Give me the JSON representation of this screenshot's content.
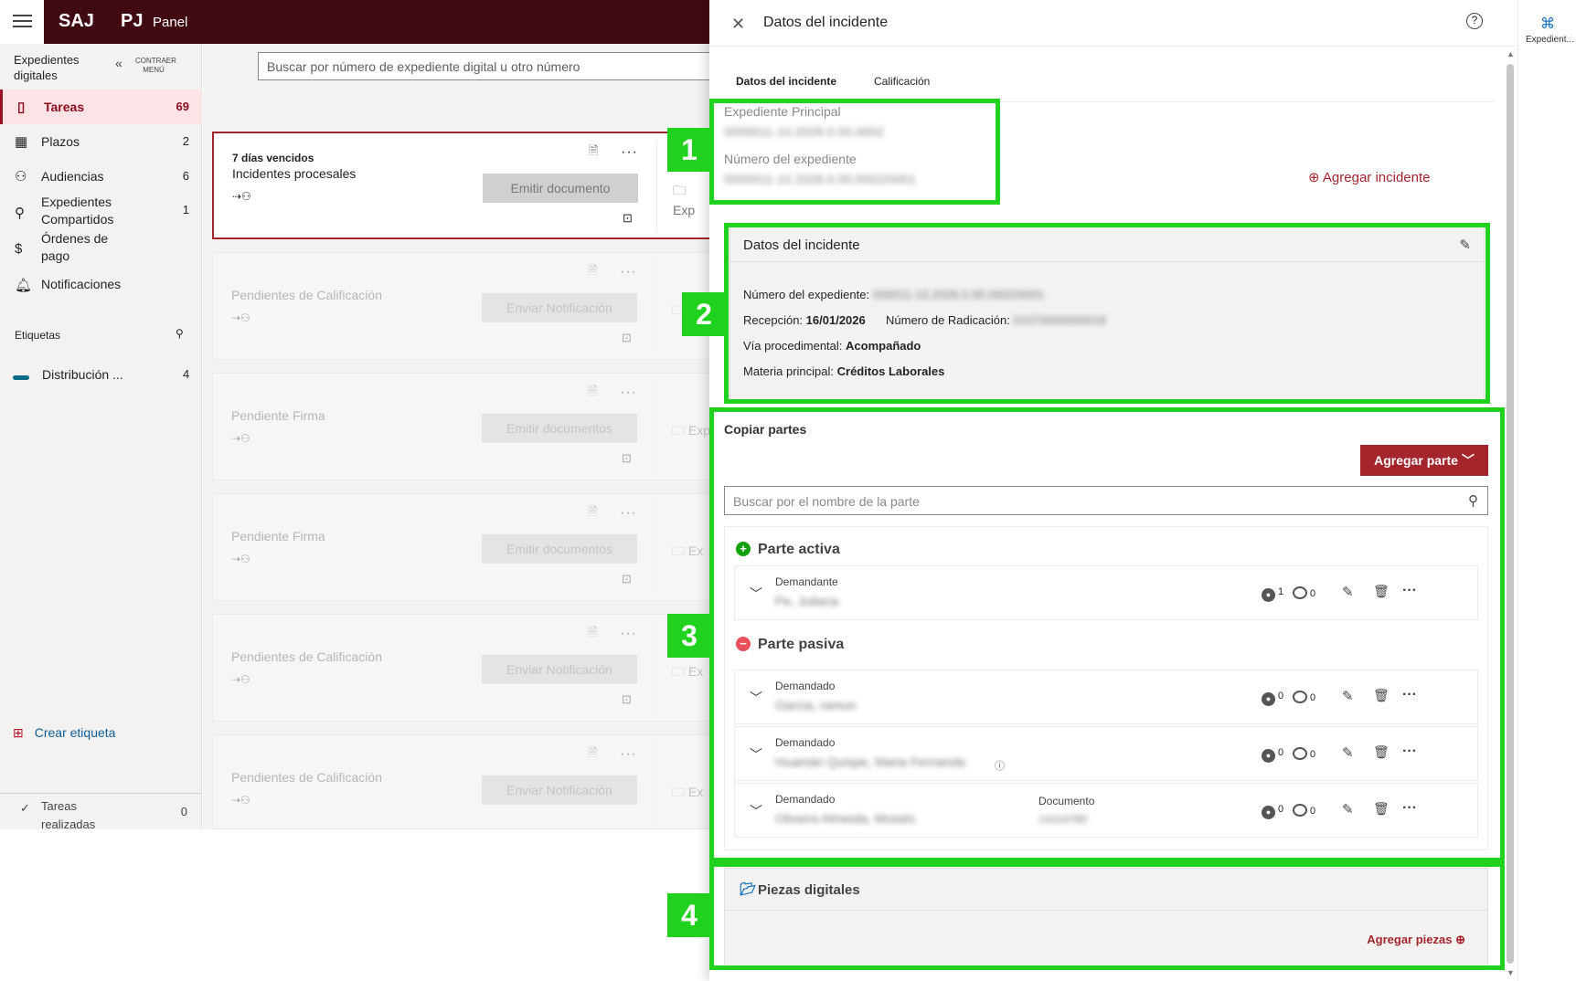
{
  "topbar": {
    "brand1": "SAJ",
    "brand2": "PJ",
    "brand3": "Panel"
  },
  "sidebar": {
    "title": "Expedientes digitales",
    "collapse_label": "CONTRAER MENÚ",
    "items": [
      {
        "label": "Tareas",
        "count": "69",
        "icon": "bookmark-icon"
      },
      {
        "label": "Plazos",
        "count": "2",
        "icon": "calendar-icon"
      },
      {
        "label": "Audiencias",
        "count": "6",
        "icon": "people-icon"
      },
      {
        "label": "Expedientes Compartidos",
        "count": "1",
        "icon": "share-person-icon"
      },
      {
        "label": "Órdenes de pago",
        "count": "",
        "icon": "dollar-icon"
      },
      {
        "label": "Notificaciones",
        "count": "",
        "icon": "bell-icon"
      }
    ],
    "tags_header": "Etiquetas",
    "tag": {
      "label": "Distribución ...",
      "count": "4",
      "color": "#0d6b8a"
    },
    "create_tag": "Crear etiqueta",
    "done": {
      "label": "Tareas realizadas",
      "count": "0"
    }
  },
  "main": {
    "search_placeholder": "Buscar por número de expediente digital u otro número",
    "cards": [
      {
        "title1": "7 días vencidos",
        "title2": "Incidentes procesales",
        "button": "Emitir documento",
        "folder": "Exp"
      },
      {
        "title": "Pendientes de Calificación",
        "button": "Enviar Notificación",
        "folder": ""
      },
      {
        "title": "Pendiente Firma",
        "button": "Emitir documentos",
        "folder": "Exp"
      },
      {
        "title": "Pendiente Firma",
        "button": "Emitir documentos",
        "folder": "Ex"
      },
      {
        "title": "Pendientes de Calificación",
        "button": "Enviar Notificación",
        "folder": "Ex"
      },
      {
        "title": "Pendientes de Calificación",
        "button": "Enviar Notificación",
        "folder": "Ex"
      }
    ]
  },
  "panel": {
    "title": "Datos del incidente",
    "tabs": [
      "Datos del incidente",
      "Calificación"
    ],
    "exp_principal_label": "Expediente Principal",
    "exp_principal_value": "0000011-10.2026.0.00.0002",
    "num_exp_label": "Número del expediente",
    "num_exp_value": "0000011-10.2026.0.00.0002/0001",
    "add_incident": "Agregar incidente",
    "datos": {
      "header": "Datos del incidente",
      "num_exp_label": "Número del expediente:",
      "num_exp_value": "000011-10.2026.0.00.0002/0001",
      "recepcion_label": "Recepción:",
      "recepcion_value": "16/01/2026",
      "radicacion_label": "Número de Radicación:",
      "radicacion_value": "01070000000019",
      "via_label": "Vía procedimental:",
      "via_value": "Acompañado",
      "materia_label": "Materia principal:",
      "materia_value": "Créditos Laborales"
    },
    "copiar": "Copiar partes",
    "add_part": "Agregar parte",
    "search_part_placeholder": "Buscar por el nombre de la parte",
    "activa": "Parte activa",
    "pasiva": "Parte pasiva",
    "parties": [
      {
        "role": "Demandante",
        "name": "Pe, Juliana",
        "persons": "1",
        "comments": "0",
        "doc_label": "",
        "doc_value": ""
      },
      {
        "role": "Demandado",
        "name": "Garcia, ramon",
        "persons": "0",
        "comments": "0",
        "doc_label": "",
        "doc_value": ""
      },
      {
        "role": "Demandado",
        "name": "Huamán Quispe, Maria Fernanda",
        "persons": "0",
        "comments": "0",
        "doc_label": "",
        "doc_value": ""
      },
      {
        "role": "Demandado",
        "name": "Oliveira Almeida, Moisés",
        "persons": "0",
        "comments": "0",
        "doc_label": "Documento",
        "doc_value": "14316780"
      }
    ],
    "piezas": "Piezas digitales",
    "add_piezas": "Agregar piezas"
  },
  "rail": {
    "label": "Expedient..."
  },
  "callouts": [
    "1",
    "2",
    "3",
    "4"
  ],
  "colors": {
    "accent": "#a4262c",
    "topbar": "#410a12",
    "highlight": "#20d21d"
  }
}
